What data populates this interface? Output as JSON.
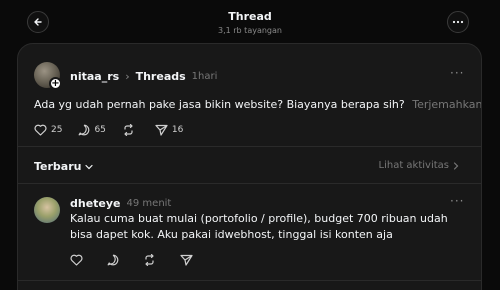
{
  "header": {
    "title": "Thread",
    "views": "3,1 rb tayangan"
  },
  "post": {
    "username": "nitaa_rs",
    "topic": "Threads",
    "time": "1hari",
    "text": "Ada yg udah pernah pake jasa bikin website? Biayanya berapa sih?",
    "translate_label": "Terjemahkan",
    "likes": "25",
    "comments": "65",
    "shares": "16"
  },
  "sort": {
    "label": "Terbaru",
    "activity_label": "Lihat aktivitas"
  },
  "reply": {
    "username": "dheteye",
    "time": "49 menit",
    "text": "Kalau cuma buat mulai (portofolio / profile), budget 700 ribuan udah bisa dapet kok. Aku pakai idwebhost, tinggal isi konten aja"
  },
  "icons": [
    "arrow-left-icon",
    "more-horizontal-icon",
    "plus-icon",
    "heart-icon",
    "comment-icon",
    "repost-icon",
    "send-icon",
    "chevron-down-icon",
    "chevron-right-icon"
  ]
}
